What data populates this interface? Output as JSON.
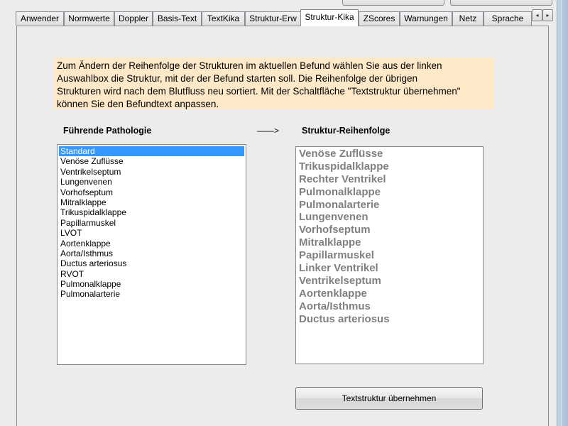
{
  "tabs": [
    {
      "label": "Anwender",
      "active": false
    },
    {
      "label": "Normwerte",
      "active": false
    },
    {
      "label": "Doppler",
      "active": false
    },
    {
      "label": "Basis-Text",
      "active": false
    },
    {
      "label": "TextKika",
      "active": false
    },
    {
      "label": "Struktur-Erw",
      "active": false
    },
    {
      "label": "Struktur-Kika",
      "active": true
    },
    {
      "label": "ZScores",
      "active": false
    },
    {
      "label": "Warnungen",
      "active": false
    },
    {
      "label": "Netz",
      "active": false
    },
    {
      "label": "Sprache",
      "active": false
    }
  ],
  "tab_scroll": {
    "left_glyph": "◂",
    "right_glyph": "▸"
  },
  "info_text": "Zum Ändern der Reihenfolge der Strukturen im aktuellen Befund  wählen Sie aus der linken\nAuswahlbox die Struktur, mit der der Befund starten soll. Die Reihenfolge der übrigen\nStrukturen wird nach dem Blutfluss neu sortiert. Mit der Schaltfläche \"Textstruktur übernehmen\"\nkönnen Sie den Befundtext anpassen.",
  "left_heading": "Führende Pathologie",
  "arrow_text": "——>",
  "right_heading": "Struktur-Reihenfolge",
  "left_list": {
    "selected_index": 0,
    "items": [
      "Standard",
      "Venöse Zuflüsse",
      "Ventrikelseptum",
      "Lungenvenen",
      "Vorhofseptum",
      "Mitralklappe",
      "Trikuspidalklappe",
      "Papillarmuskel",
      "LVOT",
      "Aortenklappe",
      "Aorta/Isthmus",
      "Ductus arteriosus",
      "RVOT",
      "Pulmonalklappe",
      "Pulmonalarterie"
    ]
  },
  "right_list": {
    "items": [
      "Venöse Zuflüsse",
      "Trikuspidalklappe",
      "Rechter Ventrikel",
      "Pulmonalklappe",
      "Pulmonalarterie",
      "Lungenvenen",
      "Vorhofseptum",
      "Mitralklappe",
      "Papillarmuskel",
      "Linker Ventrikel",
      "Ventrikelseptum",
      "Aortenklappe",
      "Aorta/Isthmus",
      "Ductus arteriosus"
    ]
  },
  "apply_button_label": "Textstruktur übernehmen",
  "colors": {
    "info_background": "#fde8c8",
    "selection": "#3399ff",
    "disabled_text": "#808080"
  }
}
